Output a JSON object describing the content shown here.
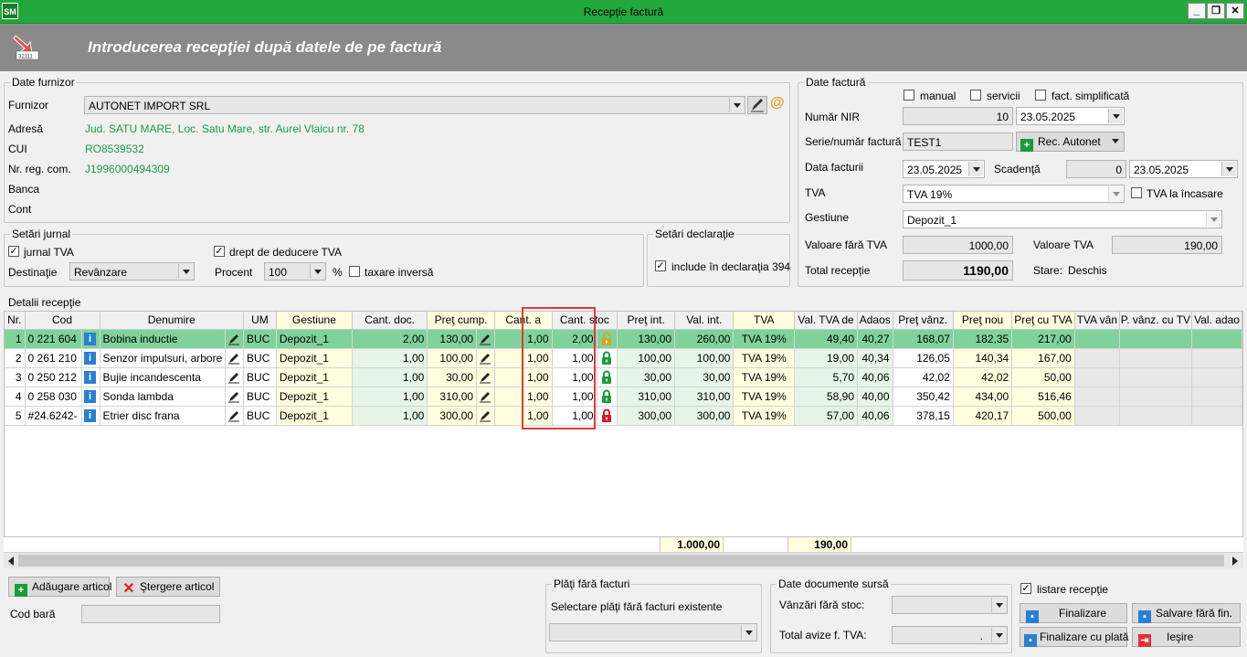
{
  "window": {
    "title": "Recepție factură",
    "minimize": "_",
    "restore": "❐",
    "close": "✕"
  },
  "header": {
    "title": "Introducerea recepţiei după datele de pe factură",
    "icon_code": "32111"
  },
  "supplier": {
    "legend": "Date furnizor",
    "furnizor_label": "Furnizor",
    "furnizor_value": "AUTONET IMPORT SRL",
    "adresa_label": "Adresă",
    "adresa_value": "Jud. SATU MARE, Loc. Satu Mare, str. Aurel Vlaicu nr. 78",
    "cui_label": "CUI",
    "cui_value": "RO8539532",
    "nrreg_label": "Nr. reg. com.",
    "nrreg_value": "J1996000494309",
    "banca_label": "Banca",
    "cont_label": "Cont",
    "email_icon": "@"
  },
  "invoice": {
    "legend": "Date factură",
    "manual": "manual",
    "servicii": "servicii",
    "simplificata": "fact. simplificată",
    "nir_label": "Număr NIR",
    "nir_value": "10",
    "nir_date": "23.05.2025",
    "serie_label": "Serie/număr factură",
    "serie_value": "TEST1",
    "rec_button": "Rec. Autonet",
    "data_label": "Data facturii",
    "data_value": "23.05.2025",
    "scadenta_label": "Scadenţă",
    "scadenta_days": "0",
    "scadenta_date": "23.05.2025",
    "tva_label": "TVA",
    "tva_value": "TVA 19%",
    "tva_incasare": "TVA la încasare",
    "gestiune_label": "Gestiune",
    "gestiune_value": "Depozit_1",
    "val_fara_label": "Valoare fără TVA",
    "val_fara_value": "1000,00",
    "val_tva_label": "Valoare TVA",
    "val_tva_value": "190,00",
    "total_label": "Total recepție",
    "total_value": "1190,00",
    "stare_label": "Stare:",
    "stare_value": "Deschis"
  },
  "journal": {
    "legend": "Setări jurnal",
    "jurnal_tva": "jurnal TVA",
    "drept": "drept de deducere TVA",
    "destinatie_label": "Destinaţie",
    "destinatie_value": "Revânzare",
    "procent_label": "Procent",
    "procent_value": "100",
    "percent": "%",
    "taxare": "taxare inversă",
    "check": "✓"
  },
  "declaration": {
    "legend": "Setări declaraţie",
    "include": "include în declaraţia 394"
  },
  "details": {
    "legend": "Detalii recepţie",
    "columns": [
      "Nr.",
      "Cod",
      "Denumire",
      "UM",
      "Gestiune",
      "Cant. doc.",
      "Preţ cump.",
      "Cant. a",
      "Cant. stoc",
      "Preţ int.",
      "Val. int.",
      "TVA",
      "Val. TVA de",
      "Adaos",
      "Preţ vânz.",
      "Preţ nou",
      "Preţ cu TVA",
      "TVA vân",
      "P. vânz. cu TV",
      "Val. adao"
    ],
    "rows": [
      {
        "nr": "1",
        "cod": "0 221 604",
        "den": "Bobina inductie",
        "um": "BUC",
        "gest": "Depozit_1",
        "cdoc": "2,00",
        "pcump": "130,00",
        "ca": "1,00",
        "cstoc": "2,00",
        "pint": "130,00",
        "vint": "260,00",
        "tva": "TVA 19%",
        "vtva": "49,40",
        "adaos": "40,27",
        "pvanz": "168,07",
        "pnou": "182,35",
        "pcutva": "217,00",
        "lock": "open"
      },
      {
        "nr": "2",
        "cod": "0 261 210",
        "den": "Senzor impulsuri, arbore",
        "um": "BUC",
        "gest": "Depozit_1",
        "cdoc": "1,00",
        "pcump": "100,00",
        "ca": "1,00",
        "cstoc": "1,00",
        "pint": "100,00",
        "vint": "100,00",
        "tva": "TVA 19%",
        "vtva": "19,00",
        "adaos": "40,34",
        "pvanz": "126,05",
        "pnou": "140,34",
        "pcutva": "167,00",
        "lock": "green"
      },
      {
        "nr": "3",
        "cod": "0 250 212",
        "den": "Bujie incandescenta",
        "um": "BUC",
        "gest": "Depozit_1",
        "cdoc": "1,00",
        "pcump": "30,00",
        "ca": "1,00",
        "cstoc": "1,00",
        "pint": "30,00",
        "vint": "30,00",
        "tva": "TVA 19%",
        "vtva": "5,70",
        "adaos": "40,06",
        "pvanz": "42,02",
        "pnou": "42,02",
        "pcutva": "50,00",
        "lock": "green"
      },
      {
        "nr": "4",
        "cod": "0 258 030",
        "den": "Sonda lambda",
        "um": "BUC",
        "gest": "Depozit_1",
        "cdoc": "1,00",
        "pcump": "310,00",
        "ca": "1,00",
        "cstoc": "1,00",
        "pint": "310,00",
        "vint": "310,00",
        "tva": "TVA 19%",
        "vtva": "58,90",
        "adaos": "40,00",
        "pvanz": "350,42",
        "pnou": "434,00",
        "pcutva": "516,46",
        "lock": "green"
      },
      {
        "nr": "5",
        "cod": "#24.6242-",
        "den": "Etrier disc frana",
        "um": "BUC",
        "gest": "Depozit_1",
        "cdoc": "1,00",
        "pcump": "300,00",
        "ca": "1,00",
        "cstoc": "1,00",
        "pint": "300,00",
        "vint": "300,00",
        "tva": "TVA 19%",
        "vtva": "57,00",
        "adaos": "40,06",
        "pvanz": "378,15",
        "pnou": "420,17",
        "pcutva": "500,00",
        "lock": "red"
      }
    ],
    "total_vint": "1.000,00",
    "total_vtva": "190,00",
    "info_glyph": "i"
  },
  "bottom": {
    "add": "Adăugare articol",
    "delete": "Ştergere articol",
    "codbara_label": "Cod bară",
    "plati_legend": "Plăţi fără facturi",
    "plati_label": "Selectare plăţi fără facturi existente",
    "surse_legend": "Date documente sursă",
    "vanzari_label": "Vânzări fără stoc:",
    "avize_label": "Total avize f. TVA:",
    "avize_value": ".",
    "listare": "listare recepţie",
    "finalizare": "Finalizare",
    "salvare": "Salvare fără fin.",
    "finalizare_plata": "Finalizare cu plată",
    "iesire": "Ieşire"
  }
}
